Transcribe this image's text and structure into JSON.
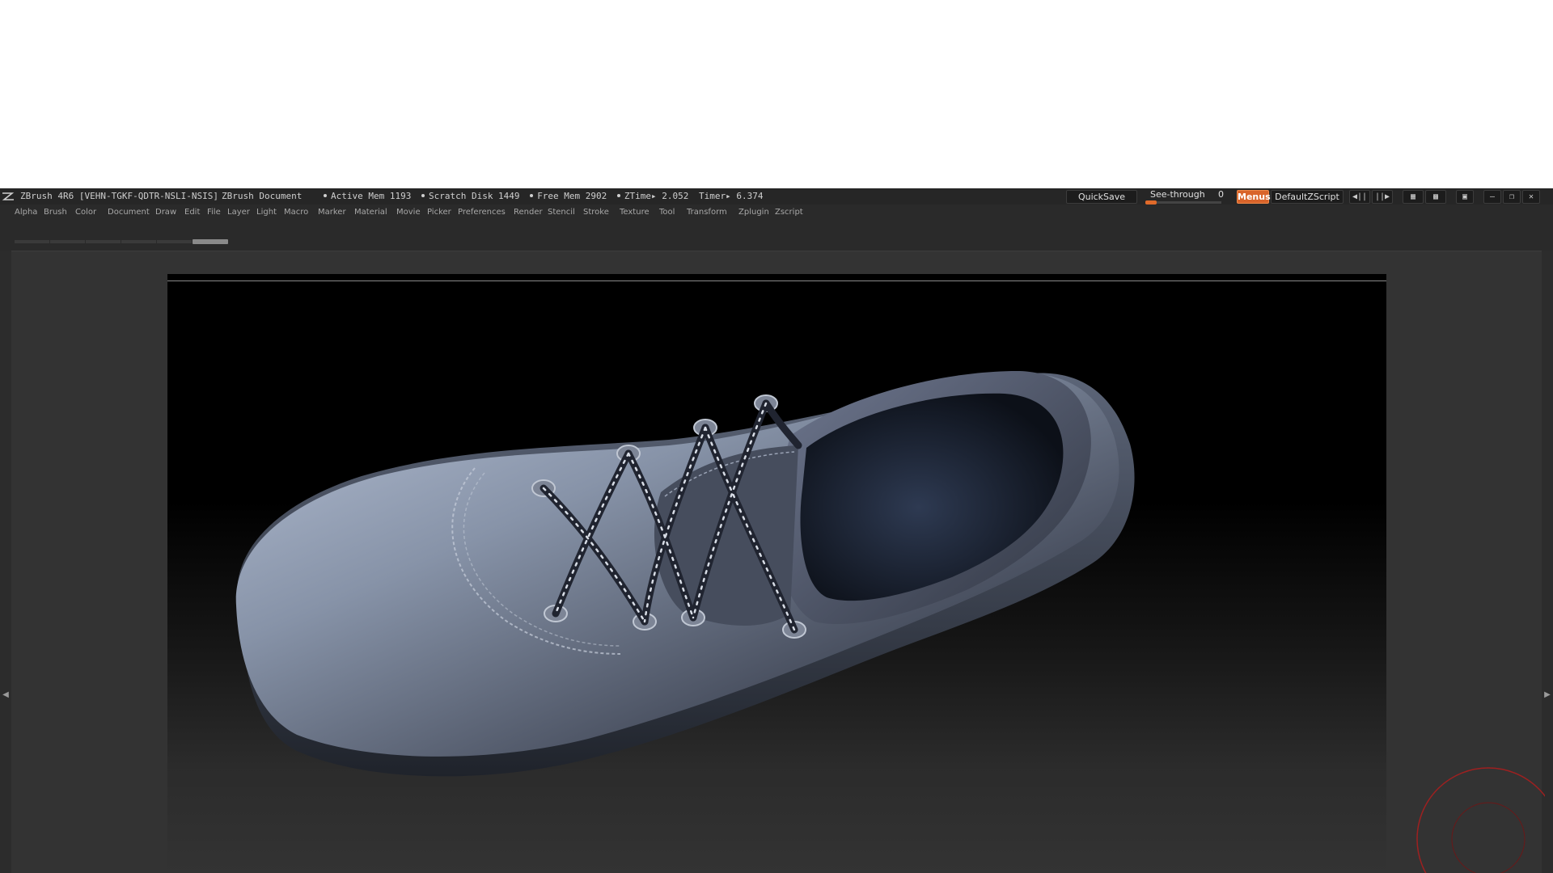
{
  "titlebar": {
    "app": "ZBrush 4R6 [VEHN-TGKF-QDTR-NSLI-NSIS]",
    "document": "ZBrush Document",
    "stats": {
      "active_mem": "Active Mem 1193",
      "scratch_disk": "Scratch Disk 1449",
      "free_mem": "Free Mem 2902",
      "ztime": "ZTime▸ 2.052",
      "timer": "Timer▸ 6.374"
    },
    "quicksave": "QuickSave",
    "see_through_label": "See-through",
    "see_through_value": "0",
    "menus": "Menus",
    "default_zscript": "DefaultZScript"
  },
  "menubar": {
    "items": [
      "Alpha",
      "Brush",
      "Color",
      "Document",
      "Draw",
      "Edit",
      "File",
      "Layer",
      "Light",
      "Macro",
      "Marker",
      "Material",
      "Movie",
      "Picker",
      "Preferences",
      "Render",
      "Stencil",
      "Stroke",
      "Texture",
      "Tool",
      "Transform",
      "Zplugin",
      "Zscript"
    ]
  },
  "colors": {
    "accent": "#d9642a",
    "background": "#2a2a2a",
    "canvas": "#000000"
  },
  "icons": [
    "zbrush-logo-icon",
    "palette-scroll-left-icon",
    "palette-scroll-right-icon",
    "layout-icon",
    "lock-icon",
    "minimize-icon",
    "restore-icon",
    "close-icon",
    "shelf-arrow-left-icon",
    "shelf-arrow-right-icon",
    "navigation-gizmo-icon"
  ]
}
